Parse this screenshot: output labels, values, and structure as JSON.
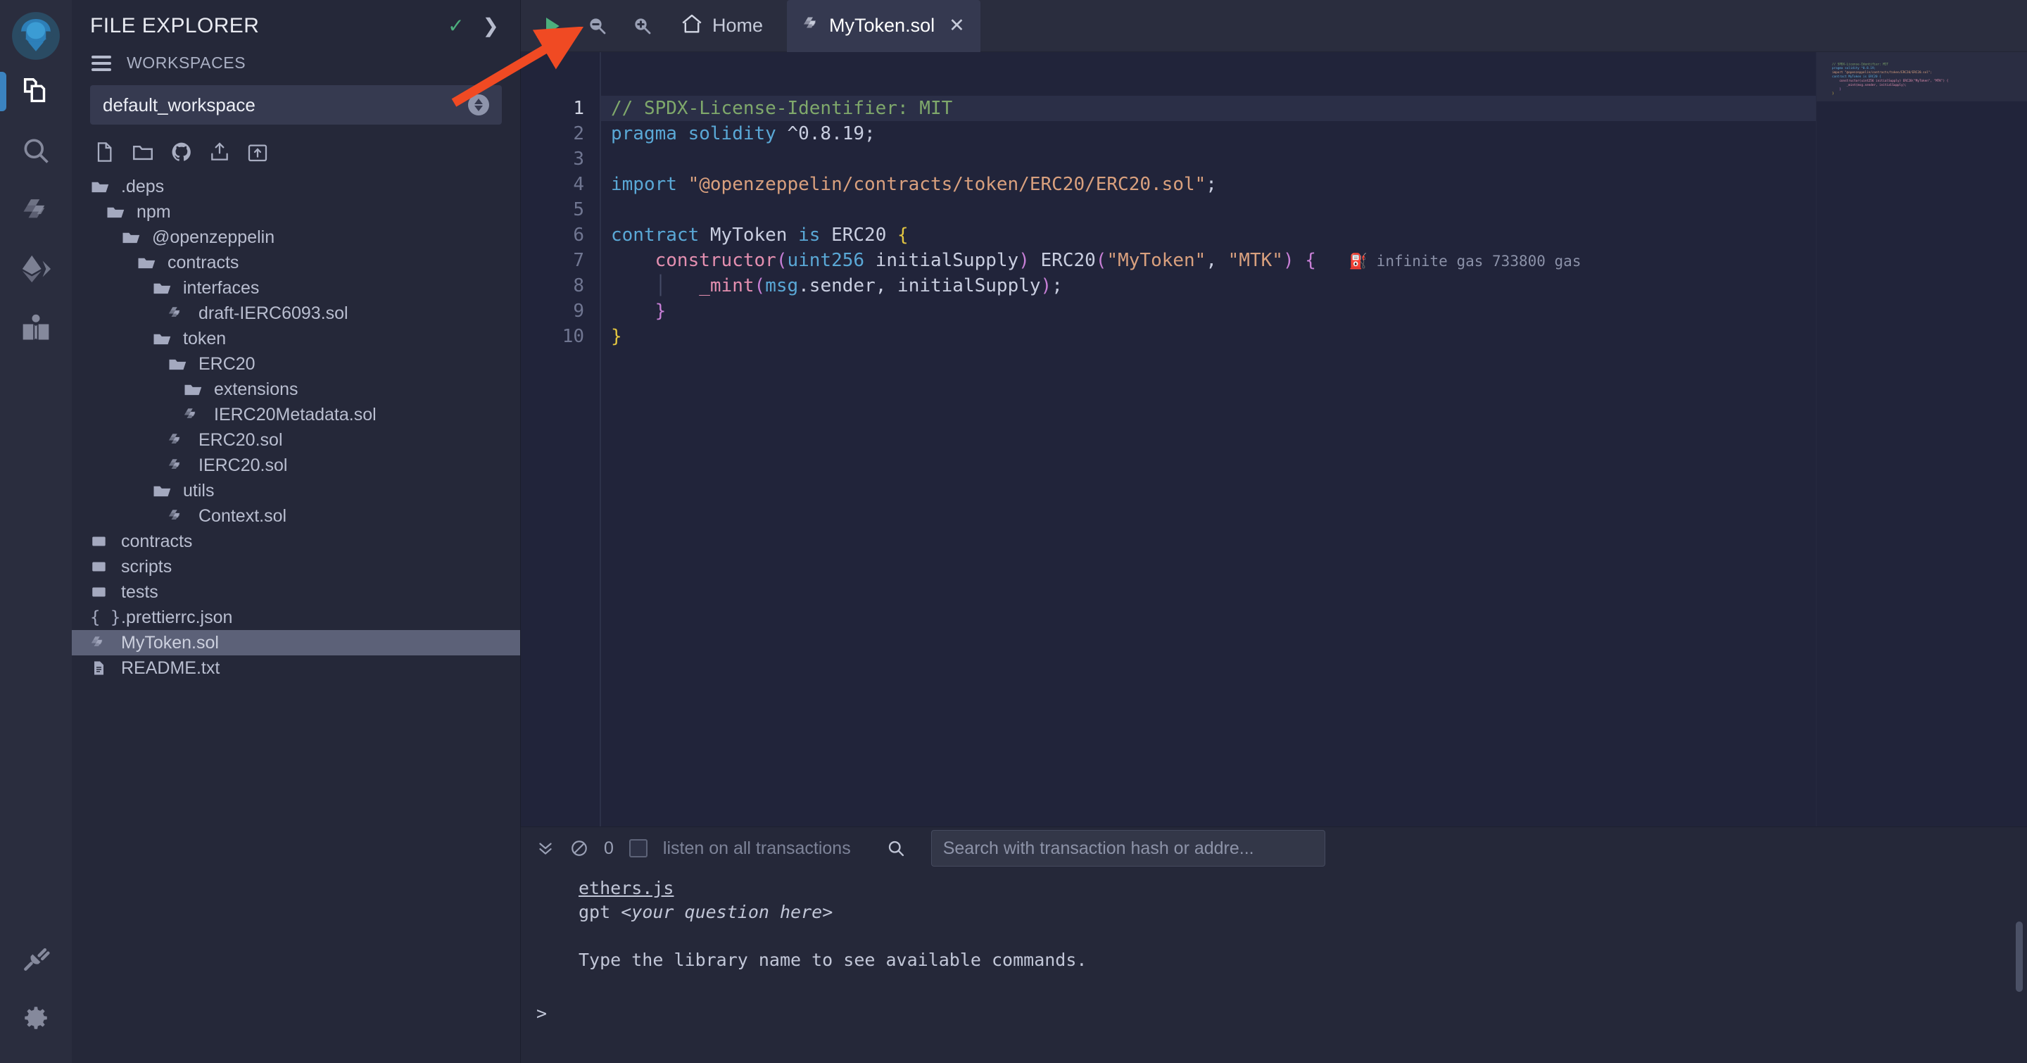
{
  "app": {
    "name": "Remix IDE"
  },
  "sidebar_icons": [
    {
      "name": "remix-logo",
      "label": "Remix"
    },
    {
      "name": "file-explorer-icon",
      "label": "File explorer",
      "active": true
    },
    {
      "name": "search-icon",
      "label": "Search in files"
    },
    {
      "name": "solidity-compiler-icon",
      "label": "Solidity compiler"
    },
    {
      "name": "deploy-run-icon",
      "label": "Deploy & run transactions"
    },
    {
      "name": "debugger-icon",
      "label": "Debugger"
    },
    {
      "name": "plugin-manager-icon",
      "label": "Plugin manager"
    },
    {
      "name": "settings-icon",
      "label": "Settings"
    }
  ],
  "explorer": {
    "title": "FILE EXPLORER",
    "check_icon": "✓",
    "chevron_icon": "❯",
    "workspaces_label": "WORKSPACES",
    "workspace_selected": "default_workspace",
    "actions": [
      {
        "name": "create-new-file-icon",
        "label": "Create new file"
      },
      {
        "name": "create-new-folder-icon",
        "label": "Create new folder"
      },
      {
        "name": "github-clone-icon",
        "label": "Clone git repository"
      },
      {
        "name": "publish-to-gist-icon",
        "label": "Publish to gist"
      },
      {
        "name": "upload-folder-icon",
        "label": "Upload folder"
      }
    ],
    "tree": [
      {
        "label": ".deps",
        "icon": "folder-open",
        "depth": 0,
        "selected": false
      },
      {
        "label": "npm",
        "icon": "folder-open",
        "depth": 1,
        "selected": false
      },
      {
        "label": "@openzeppelin",
        "icon": "folder-open",
        "depth": 2,
        "selected": false
      },
      {
        "label": "contracts",
        "icon": "folder-open",
        "depth": 3,
        "selected": false
      },
      {
        "label": "interfaces",
        "icon": "folder-open",
        "depth": 4,
        "selected": false
      },
      {
        "label": "draft-IERC6093.sol",
        "icon": "solidity",
        "depth": 5,
        "selected": false
      },
      {
        "label": "token",
        "icon": "folder-open",
        "depth": 4,
        "selected": false
      },
      {
        "label": "ERC20",
        "icon": "folder-open",
        "depth": 5,
        "selected": false
      },
      {
        "label": "extensions",
        "icon": "folder-open",
        "depth": 6,
        "selected": false
      },
      {
        "label": "IERC20Metadata.sol",
        "icon": "solidity",
        "depth": 6,
        "selected": false
      },
      {
        "label": "ERC20.sol",
        "icon": "solidity",
        "depth": 5,
        "selected": false
      },
      {
        "label": "IERC20.sol",
        "icon": "solidity",
        "depth": 5,
        "selected": false
      },
      {
        "label": "utils",
        "icon": "folder-open",
        "depth": 4,
        "selected": false
      },
      {
        "label": "Context.sol",
        "icon": "solidity",
        "depth": 5,
        "selected": false
      },
      {
        "label": "contracts",
        "icon": "folder-closed",
        "depth": 0,
        "selected": false
      },
      {
        "label": "scripts",
        "icon": "folder-closed",
        "depth": 0,
        "selected": false
      },
      {
        "label": "tests",
        "icon": "folder-closed",
        "depth": 0,
        "selected": false
      },
      {
        "label": ".prettierrc.json",
        "icon": "json",
        "depth": 0,
        "selected": false
      },
      {
        "label": "MyToken.sol",
        "icon": "solidity",
        "depth": 0,
        "selected": true
      },
      {
        "label": "README.txt",
        "icon": "text",
        "depth": 0,
        "selected": false
      }
    ]
  },
  "topbar": {
    "run_label": "Run",
    "zoom_out_label": "Zoom out",
    "zoom_in_label": "Zoom in",
    "home_label": "Home",
    "tab_label": "MyToken.sol",
    "tab_close_icon": "✕"
  },
  "editor": {
    "line_numbers": [
      "1",
      "2",
      "3",
      "4",
      "5",
      "6",
      "7",
      "8",
      "9",
      "10"
    ],
    "current_line": 1,
    "gas_annotation": "infinite gas 733800 gas",
    "code_plain": [
      "// SPDX-License-Identifier: MIT",
      "pragma solidity ^0.8.19;",
      "",
      "import \"@openzeppelin/contracts/token/ERC20/ERC20.sol\";",
      "",
      "contract MyToken is ERC20 {",
      "    constructor(uint256 initialSupply) ERC20(\"MyToken\", \"MTK\") {",
      "        _mint(msg.sender, initialSupply);",
      "    }",
      "}"
    ]
  },
  "terminal": {
    "toggle_icon_label": "Toggle terminal",
    "clear_icon_label": "Clear console",
    "count": "0",
    "listen_label": "listen on all transactions",
    "search_placeholder": "Search with transaction hash or addre...",
    "lines": [
      {
        "bullet": true,
        "link": "ethers.js",
        "text": ""
      },
      {
        "bullet": true,
        "link": "",
        "text": "gpt ",
        "italic": "<your question here>"
      },
      {
        "bullet": false,
        "link": "",
        "text": ""
      },
      {
        "bullet": false,
        "link": "",
        "text": "Type the library name to see available commands."
      }
    ],
    "prompt": ">"
  },
  "annotation": {
    "arrow_color": "#f04a23"
  },
  "colors": {
    "accent": "#3b83c0",
    "run_green": "#4caf7d",
    "comment": "#7fa86b",
    "keyword": "#5aa8d6",
    "string": "#d9a07e",
    "function": "#e48fb0",
    "brace_yellow": "#e2c541",
    "brace_purple": "#c77fd6",
    "panel_bg": "#252839",
    "editor_bg": "#21243a"
  }
}
